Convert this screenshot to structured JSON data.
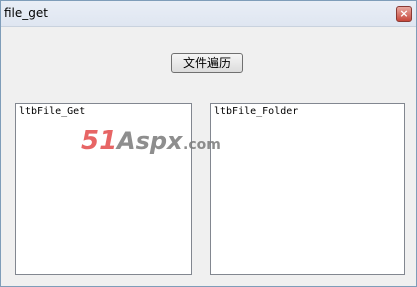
{
  "window": {
    "title": "file_get",
    "close_glyph": "×"
  },
  "main": {
    "traverse_button_label": "文件遍历",
    "list_file_name": "ltbFile_Get",
    "list_folder_name": "ltbFile_Folder"
  },
  "watermark": {
    "text_51": "51",
    "text_aspx": "Aspx",
    "text_com": ".com"
  }
}
